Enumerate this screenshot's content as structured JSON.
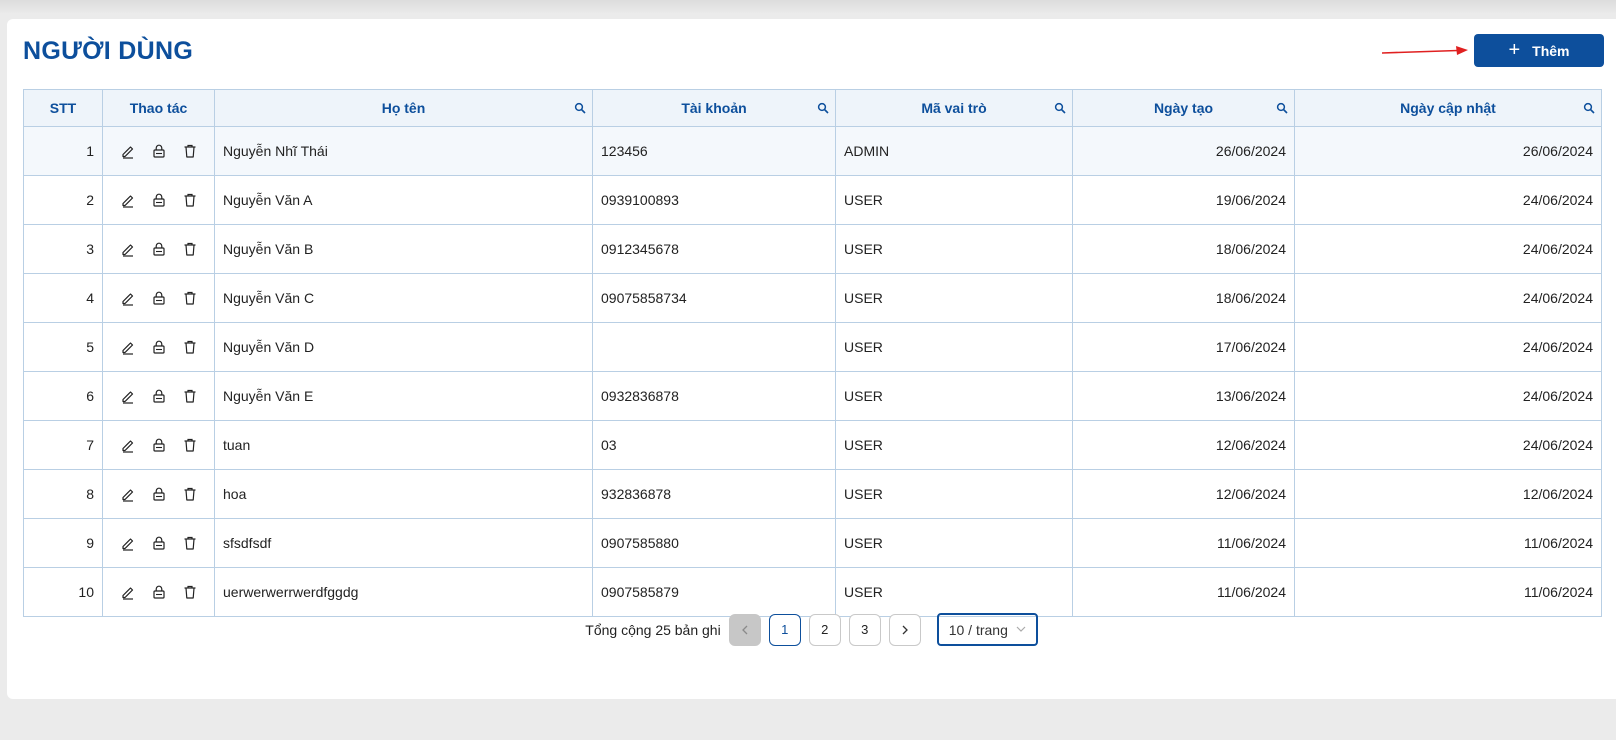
{
  "page": {
    "title": "NGƯỜI DÙNG",
    "add_label": "Thêm"
  },
  "table": {
    "headers": [
      "STT",
      "Thao tác",
      "Họ tên",
      "Tài khoản",
      "Mã vai trò",
      "Ngày tạo",
      "Ngày cập nhật"
    ],
    "rows": [
      {
        "stt": "1",
        "name": "Nguyễn Nhĩ Thái",
        "account": "123456",
        "role": "ADMIN",
        "created": "26/06/2024",
        "updated": "26/06/2024"
      },
      {
        "stt": "2",
        "name": "Nguyễn Văn A",
        "account": "0939100893",
        "role": "USER",
        "created": "19/06/2024",
        "updated": "24/06/2024"
      },
      {
        "stt": "3",
        "name": "Nguyễn Văn B",
        "account": "0912345678",
        "role": "USER",
        "created": "18/06/2024",
        "updated": "24/06/2024"
      },
      {
        "stt": "4",
        "name": "Nguyễn Văn C",
        "account": "09075858734",
        "role": "USER",
        "created": "18/06/2024",
        "updated": "24/06/2024"
      },
      {
        "stt": "5",
        "name": "Nguyễn Văn D",
        "account": "",
        "role": "USER",
        "created": "17/06/2024",
        "updated": "24/06/2024"
      },
      {
        "stt": "6",
        "name": "Nguyễn Văn E",
        "account": "0932836878",
        "role": "USER",
        "created": "13/06/2024",
        "updated": "24/06/2024"
      },
      {
        "stt": "7",
        "name": "tuan",
        "account": "03",
        "role": "USER",
        "created": "12/06/2024",
        "updated": "24/06/2024"
      },
      {
        "stt": "8",
        "name": "hoa",
        "account": "932836878",
        "role": "USER",
        "created": "12/06/2024",
        "updated": "12/06/2024"
      },
      {
        "stt": "9",
        "name": "sfsdfsdf",
        "account": "0907585880",
        "role": "USER",
        "created": "11/06/2024",
        "updated": "11/06/2024"
      },
      {
        "stt": "10",
        "name": "uerwerwerrwerdfggdg",
        "account": "0907585879",
        "role": "USER",
        "created": "11/06/2024",
        "updated": "11/06/2024"
      }
    ]
  },
  "pagination": {
    "total_text": "Tổng cộng 25 bản ghi",
    "pages": [
      "1",
      "2",
      "3"
    ],
    "current_page": "1",
    "page_size": "10 / trang"
  },
  "colors": {
    "primary": "#0d4f9c",
    "header_bg": "#eef4fa",
    "border": "#b9cfe4",
    "arrow": "#e02020"
  },
  "icons": [
    "plus-icon",
    "search-icon",
    "edit-icon",
    "lock-icon",
    "delete-icon",
    "chevron-left-icon",
    "chevron-right-icon",
    "chevron-down-icon"
  ]
}
